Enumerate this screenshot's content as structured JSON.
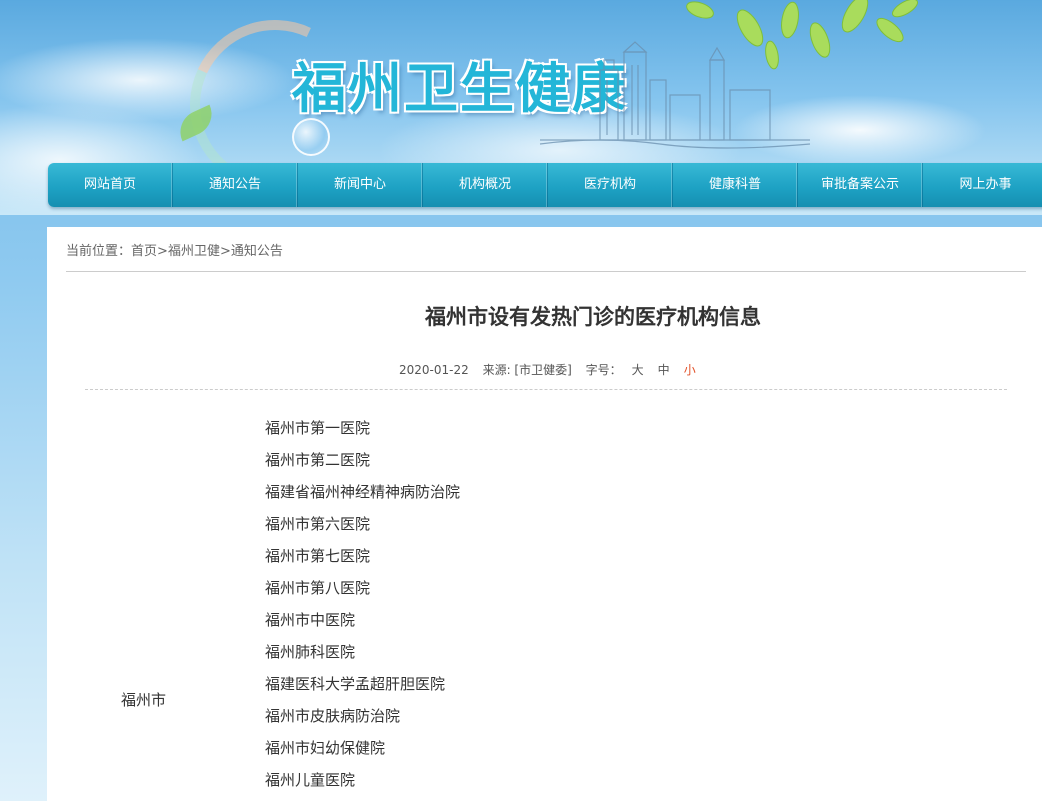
{
  "header": {
    "site_title": "福州卫生健康"
  },
  "nav": {
    "items": [
      {
        "label": "网站首页",
        "name": "nav-home"
      },
      {
        "label": "通知公告",
        "name": "nav-notices"
      },
      {
        "label": "新闻中心",
        "name": "nav-news"
      },
      {
        "label": "机构概况",
        "name": "nav-overview"
      },
      {
        "label": "医疗机构",
        "name": "nav-medical-institutions"
      },
      {
        "label": "健康科普",
        "name": "nav-health-education"
      },
      {
        "label": "审批备案公示",
        "name": "nav-approval-filing"
      },
      {
        "label": "网上办事",
        "name": "nav-online-services"
      }
    ]
  },
  "breadcrumb": {
    "prefix": "当前位置：",
    "items": [
      "首页",
      "福州卫健",
      "通知公告"
    ],
    "separator": ">"
  },
  "article": {
    "title": "福州市设有发热门诊的医疗机构信息",
    "date": "2020-01-22",
    "source": "来源: [市卫健委]",
    "font_size_label": "字号：",
    "font_size_options": [
      "大",
      "中",
      "小"
    ],
    "active_font_size": "小"
  },
  "table": {
    "city": "福州市",
    "hospitals": [
      "福州市第一医院",
      "福州市第二医院",
      "福建省福州神经精神病防治院",
      "福州市第六医院",
      "福州市第七医院",
      "福州市第八医院",
      "福州市中医院",
      "福州肺科医院",
      "福建医科大学孟超肝胆医院",
      "福州市皮肤病防治院",
      "福州市妇幼保健院",
      "福州儿童医院"
    ]
  },
  "colors": {
    "nav_bg": "#1ea2c4",
    "title_blue": "#23b6d8",
    "active_size": "#e2522a"
  }
}
